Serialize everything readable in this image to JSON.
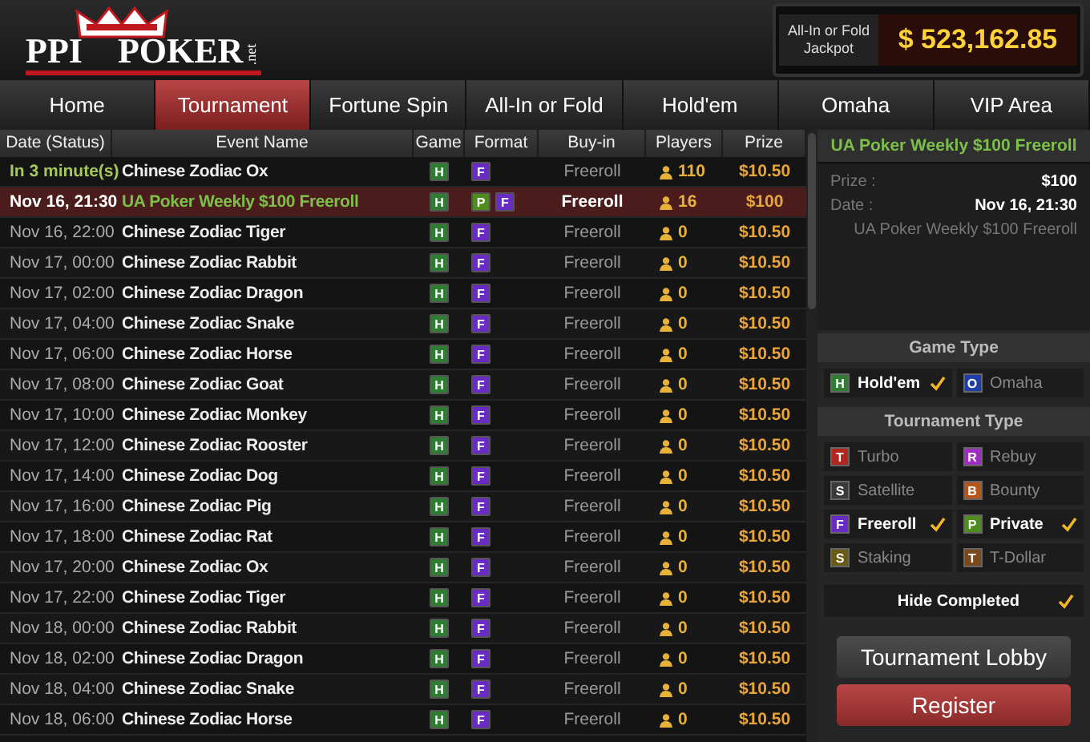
{
  "logo": {
    "left": "PPI",
    "right": "POKER",
    "suffix": ".net"
  },
  "jackpot": {
    "label": "All-In or Fold Jackpot",
    "amount": "$ 523,162.85"
  },
  "nav": [
    {
      "label": "Home",
      "selected": false
    },
    {
      "label": "Tournament",
      "selected": true
    },
    {
      "label": "Fortune Spin",
      "selected": false
    },
    {
      "label": "All-In or Fold",
      "selected": false
    },
    {
      "label": "Hold'em",
      "selected": false
    },
    {
      "label": "Omaha",
      "selected": false
    },
    {
      "label": "VIP Area",
      "selected": false
    }
  ],
  "table": {
    "columns": [
      "Date (Status)",
      "Event Name",
      "Game",
      "Format",
      "Buy-in",
      "Players",
      "Prize"
    ],
    "rows": [
      {
        "date": "In 3 minute(s)",
        "upcoming": true,
        "name": "Chinese Zodiac Ox",
        "game": [
          {
            "letter": "H",
            "color": "#2e7d32"
          }
        ],
        "format": [
          {
            "letter": "F",
            "color": "#6a2bc4"
          }
        ],
        "buyin": "Freeroll",
        "players": "110",
        "prize": "$10.50",
        "selected": false
      },
      {
        "date": "Nov 16, 21:30",
        "upcoming": false,
        "name": "UA Poker Weekly $100 Freeroll",
        "game": [
          {
            "letter": "H",
            "color": "#2e7d32"
          }
        ],
        "format": [
          {
            "letter": "P",
            "color": "#4e8c1e"
          },
          {
            "letter": "F",
            "color": "#6a2bc4"
          }
        ],
        "buyin": "Freeroll",
        "players": "16",
        "prize": "$100",
        "selected": true
      },
      {
        "date": "Nov 16, 22:00",
        "upcoming": false,
        "name": "Chinese Zodiac Tiger",
        "game": [
          {
            "letter": "H",
            "color": "#2e7d32"
          }
        ],
        "format": [
          {
            "letter": "F",
            "color": "#6a2bc4"
          }
        ],
        "buyin": "Freeroll",
        "players": "0",
        "prize": "$10.50",
        "selected": false
      },
      {
        "date": "Nov 17, 00:00",
        "upcoming": false,
        "name": "Chinese Zodiac Rabbit",
        "game": [
          {
            "letter": "H",
            "color": "#2e7d32"
          }
        ],
        "format": [
          {
            "letter": "F",
            "color": "#6a2bc4"
          }
        ],
        "buyin": "Freeroll",
        "players": "0",
        "prize": "$10.50",
        "selected": false
      },
      {
        "date": "Nov 17, 02:00",
        "upcoming": false,
        "name": "Chinese Zodiac Dragon",
        "game": [
          {
            "letter": "H",
            "color": "#2e7d32"
          }
        ],
        "format": [
          {
            "letter": "F",
            "color": "#6a2bc4"
          }
        ],
        "buyin": "Freeroll",
        "players": "0",
        "prize": "$10.50",
        "selected": false
      },
      {
        "date": "Nov 17, 04:00",
        "upcoming": false,
        "name": "Chinese Zodiac Snake",
        "game": [
          {
            "letter": "H",
            "color": "#2e7d32"
          }
        ],
        "format": [
          {
            "letter": "F",
            "color": "#6a2bc4"
          }
        ],
        "buyin": "Freeroll",
        "players": "0",
        "prize": "$10.50",
        "selected": false
      },
      {
        "date": "Nov 17, 06:00",
        "upcoming": false,
        "name": "Chinese Zodiac Horse",
        "game": [
          {
            "letter": "H",
            "color": "#2e7d32"
          }
        ],
        "format": [
          {
            "letter": "F",
            "color": "#6a2bc4"
          }
        ],
        "buyin": "Freeroll",
        "players": "0",
        "prize": "$10.50",
        "selected": false
      },
      {
        "date": "Nov 17, 08:00",
        "upcoming": false,
        "name": "Chinese Zodiac Goat",
        "game": [
          {
            "letter": "H",
            "color": "#2e7d32"
          }
        ],
        "format": [
          {
            "letter": "F",
            "color": "#6a2bc4"
          }
        ],
        "buyin": "Freeroll",
        "players": "0",
        "prize": "$10.50",
        "selected": false
      },
      {
        "date": "Nov 17, 10:00",
        "upcoming": false,
        "name": "Chinese Zodiac Monkey",
        "game": [
          {
            "letter": "H",
            "color": "#2e7d32"
          }
        ],
        "format": [
          {
            "letter": "F",
            "color": "#6a2bc4"
          }
        ],
        "buyin": "Freeroll",
        "players": "0",
        "prize": "$10.50",
        "selected": false
      },
      {
        "date": "Nov 17, 12:00",
        "upcoming": false,
        "name": "Chinese Zodiac Rooster",
        "game": [
          {
            "letter": "H",
            "color": "#2e7d32"
          }
        ],
        "format": [
          {
            "letter": "F",
            "color": "#6a2bc4"
          }
        ],
        "buyin": "Freeroll",
        "players": "0",
        "prize": "$10.50",
        "selected": false
      },
      {
        "date": "Nov 17, 14:00",
        "upcoming": false,
        "name": "Chinese Zodiac Dog",
        "game": [
          {
            "letter": "H",
            "color": "#2e7d32"
          }
        ],
        "format": [
          {
            "letter": "F",
            "color": "#6a2bc4"
          }
        ],
        "buyin": "Freeroll",
        "players": "0",
        "prize": "$10.50",
        "selected": false
      },
      {
        "date": "Nov 17, 16:00",
        "upcoming": false,
        "name": "Chinese Zodiac Pig",
        "game": [
          {
            "letter": "H",
            "color": "#2e7d32"
          }
        ],
        "format": [
          {
            "letter": "F",
            "color": "#6a2bc4"
          }
        ],
        "buyin": "Freeroll",
        "players": "0",
        "prize": "$10.50",
        "selected": false
      },
      {
        "date": "Nov 17, 18:00",
        "upcoming": false,
        "name": "Chinese Zodiac Rat",
        "game": [
          {
            "letter": "H",
            "color": "#2e7d32"
          }
        ],
        "format": [
          {
            "letter": "F",
            "color": "#6a2bc4"
          }
        ],
        "buyin": "Freeroll",
        "players": "0",
        "prize": "$10.50",
        "selected": false
      },
      {
        "date": "Nov 17, 20:00",
        "upcoming": false,
        "name": "Chinese Zodiac Ox",
        "game": [
          {
            "letter": "H",
            "color": "#2e7d32"
          }
        ],
        "format": [
          {
            "letter": "F",
            "color": "#6a2bc4"
          }
        ],
        "buyin": "Freeroll",
        "players": "0",
        "prize": "$10.50",
        "selected": false
      },
      {
        "date": "Nov 17, 22:00",
        "upcoming": false,
        "name": "Chinese Zodiac Tiger",
        "game": [
          {
            "letter": "H",
            "color": "#2e7d32"
          }
        ],
        "format": [
          {
            "letter": "F",
            "color": "#6a2bc4"
          }
        ],
        "buyin": "Freeroll",
        "players": "0",
        "prize": "$10.50",
        "selected": false
      },
      {
        "date": "Nov 18, 00:00",
        "upcoming": false,
        "name": "Chinese Zodiac Rabbit",
        "game": [
          {
            "letter": "H",
            "color": "#2e7d32"
          }
        ],
        "format": [
          {
            "letter": "F",
            "color": "#6a2bc4"
          }
        ],
        "buyin": "Freeroll",
        "players": "0",
        "prize": "$10.50",
        "selected": false
      },
      {
        "date": "Nov 18, 02:00",
        "upcoming": false,
        "name": "Chinese Zodiac Dragon",
        "game": [
          {
            "letter": "H",
            "color": "#2e7d32"
          }
        ],
        "format": [
          {
            "letter": "F",
            "color": "#6a2bc4"
          }
        ],
        "buyin": "Freeroll",
        "players": "0",
        "prize": "$10.50",
        "selected": false
      },
      {
        "date": "Nov 18, 04:00",
        "upcoming": false,
        "name": "Chinese Zodiac Snake",
        "game": [
          {
            "letter": "H",
            "color": "#2e7d32"
          }
        ],
        "format": [
          {
            "letter": "F",
            "color": "#6a2bc4"
          }
        ],
        "buyin": "Freeroll",
        "players": "0",
        "prize": "$10.50",
        "selected": false
      },
      {
        "date": "Nov 18, 06:00",
        "upcoming": false,
        "name": "Chinese Zodiac Horse",
        "game": [
          {
            "letter": "H",
            "color": "#2e7d32"
          }
        ],
        "format": [
          {
            "letter": "F",
            "color": "#6a2bc4"
          }
        ],
        "buyin": "Freeroll",
        "players": "0",
        "prize": "$10.50",
        "selected": false
      }
    ]
  },
  "details": {
    "title": "UA Poker Weekly $100 Freeroll",
    "prize_label": "Prize :",
    "prize": "$100",
    "date_label": "Date :",
    "date": "Nov 16, 21:30",
    "description": "UA Poker Weekly $100 Freeroll"
  },
  "game_type": {
    "title": "Game Type",
    "options": [
      {
        "letter": "H",
        "color": "#2e7d32",
        "label": "Hold'em",
        "checked": true
      },
      {
        "letter": "O",
        "color": "#1e3fa8",
        "label": "Omaha",
        "checked": false
      }
    ]
  },
  "tournament_type": {
    "title": "Tournament Type",
    "options": [
      {
        "letter": "T",
        "color": "#b3261e",
        "label": "Turbo",
        "checked": false
      },
      {
        "letter": "R",
        "color": "#a02cc4",
        "label": "Rebuy",
        "checked": false
      },
      {
        "letter": "S",
        "color": "#3a3a3a",
        "label": "Satellite",
        "checked": false
      },
      {
        "letter": "B",
        "color": "#b5561a",
        "label": "Bounty",
        "checked": false
      },
      {
        "letter": "F",
        "color": "#6a2bc4",
        "label": "Freeroll",
        "checked": true
      },
      {
        "letter": "P",
        "color": "#4e8c1e",
        "label": "Private",
        "checked": true
      },
      {
        "letter": "S",
        "color": "#6b5a10",
        "label": "Staking",
        "checked": false
      },
      {
        "letter": "T",
        "color": "#7a4a1c",
        "label": "T-Dollar",
        "checked": false
      }
    ]
  },
  "hide_completed": {
    "label": "Hide Completed",
    "checked": true
  },
  "buttons": [
    {
      "label": "Tournament Lobby",
      "kind": "secondary"
    },
    {
      "label": "Register",
      "kind": "primary"
    }
  ]
}
